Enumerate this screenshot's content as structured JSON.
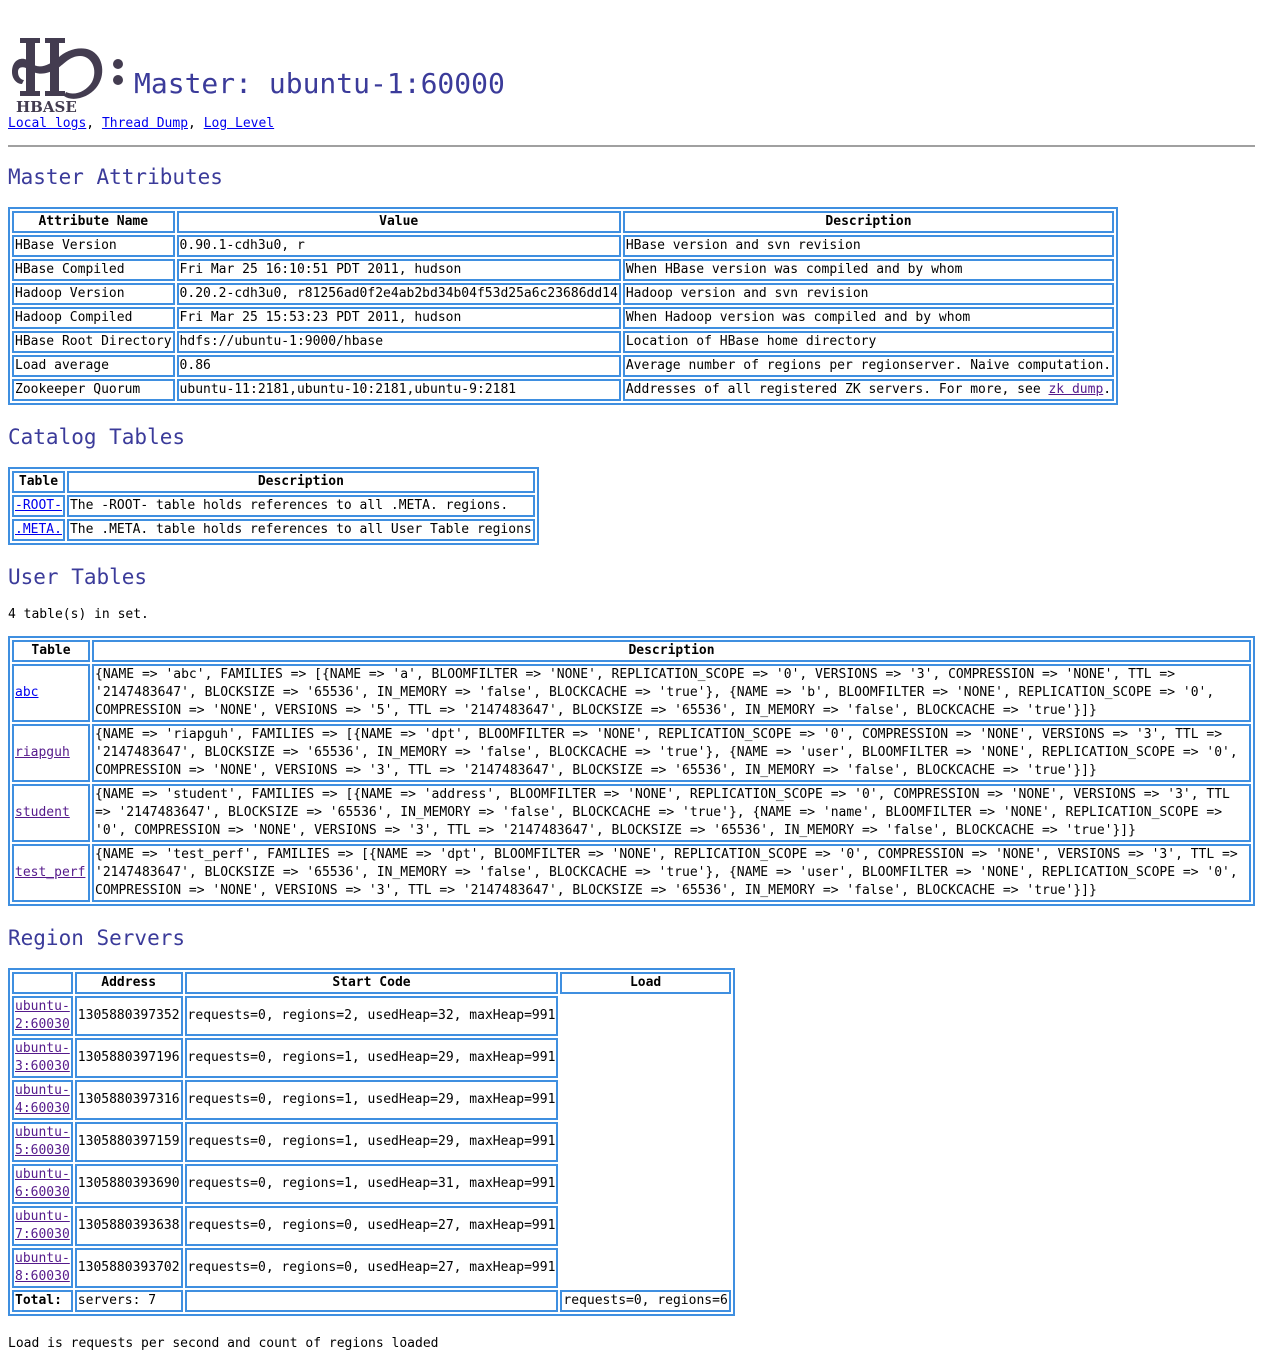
{
  "header": {
    "logo_text": "HBASE",
    "title": "Master: ubuntu-1:60000",
    "links": [
      {
        "label": "Local logs",
        "sep": ","
      },
      {
        "label": "Thread Dump",
        "sep": ","
      },
      {
        "label": "Log Level",
        "sep": ""
      }
    ]
  },
  "master_attributes": {
    "heading": "Master Attributes",
    "columns": [
      "Attribute Name",
      "Value",
      "Description"
    ],
    "rows": [
      {
        "name": "HBase Version",
        "value": "0.90.1-cdh3u0, r",
        "desc": "HBase version and svn revision"
      },
      {
        "name": "HBase Compiled",
        "value": "Fri Mar 25 16:10:51 PDT 2011, hudson",
        "desc": "When HBase version was compiled and by whom"
      },
      {
        "name": "Hadoop Version",
        "value": "0.20.2-cdh3u0, r81256ad0f2e4ab2bd34b04f53d25a6c23686dd14",
        "desc": "Hadoop version and svn revision"
      },
      {
        "name": "Hadoop Compiled",
        "value": "Fri Mar 25 15:53:23 PDT 2011, hudson",
        "desc": "When Hadoop version was compiled and by whom"
      },
      {
        "name": "HBase Root Directory",
        "value": "hdfs://ubuntu-1:9000/hbase",
        "desc": "Location of HBase home directory"
      },
      {
        "name": "Load average",
        "value": "0.86",
        "desc": "Average number of regions per regionserver. Naive computation."
      },
      {
        "name": "Zookeeper Quorum",
        "value": "ubuntu-11:2181,ubuntu-10:2181,ubuntu-9:2181",
        "desc": "Addresses of all registered ZK servers. For more, see ",
        "link": "zk dump",
        "desc_suffix": "."
      }
    ]
  },
  "catalog_tables": {
    "heading": "Catalog Tables",
    "columns": [
      "Table",
      "Description"
    ],
    "rows": [
      {
        "table": "-ROOT-",
        "desc": "The -ROOT- table holds references to all .META. regions."
      },
      {
        "table": ".META.",
        "desc": "The .META. table holds references to all User Table regions"
      }
    ]
  },
  "user_tables": {
    "heading": "User Tables",
    "count_text": "4 table(s) in set.",
    "columns": [
      "Table",
      "Description"
    ],
    "rows": [
      {
        "table": "abc",
        "visited": false,
        "desc": "{NAME => 'abc', FAMILIES => [{NAME => 'a', BLOOMFILTER => 'NONE', REPLICATION_SCOPE => '0', VERSIONS => '3', COMPRESSION => 'NONE', TTL => '2147483647', BLOCKSIZE => '65536', IN_MEMORY => 'false', BLOCKCACHE => 'true'}, {NAME => 'b', BLOOMFILTER => 'NONE', REPLICATION_SCOPE => '0', COMPRESSION => 'NONE', VERSIONS => '5', TTL => '2147483647', BLOCKSIZE => '65536', IN_MEMORY => 'false', BLOCKCACHE => 'true'}]}"
      },
      {
        "table": "riapguh",
        "visited": true,
        "desc": "{NAME => 'riapguh', FAMILIES => [{NAME => 'dpt', BLOOMFILTER => 'NONE', REPLICATION_SCOPE => '0', COMPRESSION => 'NONE', VERSIONS => '3', TTL => '2147483647', BLOCKSIZE => '65536', IN_MEMORY => 'false', BLOCKCACHE => 'true'}, {NAME => 'user', BLOOMFILTER => 'NONE', REPLICATION_SCOPE => '0', COMPRESSION => 'NONE', VERSIONS => '3', TTL => '2147483647', BLOCKSIZE => '65536', IN_MEMORY => 'false', BLOCKCACHE => 'true'}]}"
      },
      {
        "table": "student",
        "visited": true,
        "desc": "{NAME => 'student', FAMILIES => [{NAME => 'address', BLOOMFILTER => 'NONE', REPLICATION_SCOPE => '0', COMPRESSION => 'NONE', VERSIONS => '3', TTL => '2147483647', BLOCKSIZE => '65536', IN_MEMORY => 'false', BLOCKCACHE => 'true'}, {NAME => 'name', BLOOMFILTER => 'NONE', REPLICATION_SCOPE => '0', COMPRESSION => 'NONE', VERSIONS => '3', TTL => '2147483647', BLOCKSIZE => '65536', IN_MEMORY => 'false', BLOCKCACHE => 'true'}]}"
      },
      {
        "table": "test_perf",
        "visited": true,
        "desc": "{NAME => 'test_perf', FAMILIES => [{NAME => 'dpt', BLOOMFILTER => 'NONE', REPLICATION_SCOPE => '0', COMPRESSION => 'NONE', VERSIONS => '3', TTL => '2147483647', BLOCKSIZE => '65536', IN_MEMORY => 'false', BLOCKCACHE => 'true'}, {NAME => 'user', BLOOMFILTER => 'NONE', REPLICATION_SCOPE => '0', COMPRESSION => 'NONE', VERSIONS => '3', TTL => '2147483647', BLOCKSIZE => '65536', IN_MEMORY => 'false', BLOCKCACHE => 'true'}]}"
      }
    ]
  },
  "region_servers": {
    "heading": "Region Servers",
    "columns": [
      "Address",
      "Start Code",
      "Load"
    ],
    "rows": [
      {
        "address": "ubuntu-2:60030",
        "start_code": "1305880397352",
        "load": "requests=0, regions=2, usedHeap=32, maxHeap=991"
      },
      {
        "address": "ubuntu-3:60030",
        "start_code": "1305880397196",
        "load": "requests=0, regions=1, usedHeap=29, maxHeap=991"
      },
      {
        "address": "ubuntu-4:60030",
        "start_code": "1305880397316",
        "load": "requests=0, regions=1, usedHeap=29, maxHeap=991"
      },
      {
        "address": "ubuntu-5:60030",
        "start_code": "1305880397159",
        "load": "requests=0, regions=1, usedHeap=29, maxHeap=991"
      },
      {
        "address": "ubuntu-6:60030",
        "start_code": "1305880393690",
        "load": "requests=0, regions=1, usedHeap=31, maxHeap=991"
      },
      {
        "address": "ubuntu-7:60030",
        "start_code": "1305880393638",
        "load": "requests=0, regions=0, usedHeap=27, maxHeap=991"
      },
      {
        "address": "ubuntu-8:60030",
        "start_code": "1305880393702",
        "load": "requests=0, regions=0, usedHeap=27, maxHeap=991"
      }
    ],
    "total": {
      "label": "Total:",
      "servers": "servers: 7",
      "start_code": "",
      "load": "requests=0, regions=6"
    },
    "note": "Load is requests per second and count of regions loaded"
  },
  "colors": {
    "heading": "#3b3b9a",
    "table_border": "#3f8fe0",
    "link": "#0000ee",
    "link_visited": "#551a8b"
  }
}
